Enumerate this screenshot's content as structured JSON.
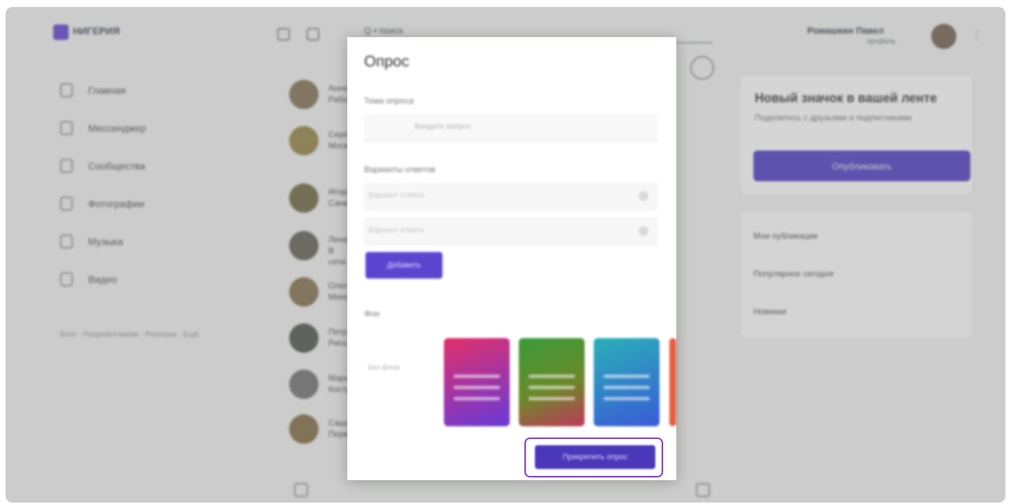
{
  "app": {
    "brand": "НИГЕРИЯ",
    "search_text": "Q • поиск",
    "user_name": "Ромашкин Павел",
    "user_sub": "профиль"
  },
  "sidebar": {
    "items": [
      {
        "label": "Главная",
        "icon": "home-icon"
      },
      {
        "label": "Мессенджер",
        "icon": "chat-icon"
      },
      {
        "label": "Сообщества",
        "icon": "groups-icon"
      },
      {
        "label": "Фотографии",
        "icon": "photo-icon"
      },
      {
        "label": "Музыка",
        "icon": "music-icon"
      },
      {
        "label": "Видео",
        "icon": "video-icon"
      }
    ],
    "footer": "Блог · Разработчикам · Реклама · Ещё"
  },
  "feed": {
    "rows": [
      {
        "line1": "Анна",
        "line2": "Работа"
      },
      {
        "line1": "Сергей",
        "line2": "Москва"
      },
      {
        "line1": "Игорь",
        "line2": "Санкт"
      },
      {
        "line1": "Лена",
        "line2": "В сети"
      },
      {
        "line1": "Олег",
        "line2": "Минск"
      },
      {
        "line1": "Петр",
        "line2": "Рига"
      },
      {
        "line1": "Мария",
        "line2": "Кострома"
      },
      {
        "line1": "Саша",
        "line2": "Пермь"
      }
    ]
  },
  "right_panel": {
    "title": "Новый значок в вашей ленте",
    "subtitle": "Поделитесь с друзьями и подписчиками",
    "button": "Опубликовать",
    "links": [
      "Мои публикации",
      "Популярное сегодня",
      "Новинки"
    ]
  },
  "modal": {
    "title": "Опрос",
    "question_label": "Тема опроса",
    "question_placeholder": "Введите вопрос",
    "options_label": "Варианты ответов",
    "option_placeholder": "Вариант ответа",
    "add_button": "Добавить",
    "background_label": "Фон",
    "background_none": "Без фона",
    "submit_button": "Прикрепить опрос"
  },
  "colors": {
    "accent": "#4a38b8",
    "highlight": "#8a2be2",
    "swatches": [
      "#c8307f",
      "#4a9a2c",
      "#2a9ec8",
      "#d85a3a"
    ]
  }
}
